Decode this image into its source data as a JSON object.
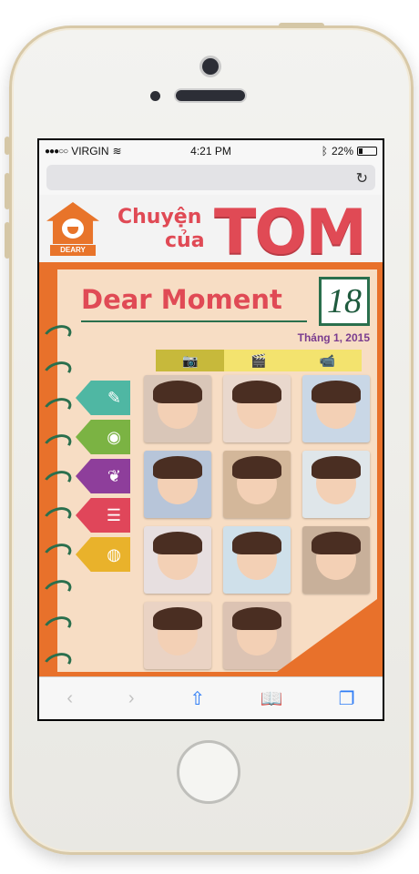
{
  "status_bar": {
    "carrier": "VIRGIN",
    "time": "4:21 PM",
    "battery": "22%"
  },
  "browser": {
    "reload_glyph": "↻"
  },
  "header": {
    "logo_text": "DEARY",
    "title_line1": "Chuyện",
    "title_line2": "của",
    "title_name": "TOM"
  },
  "page": {
    "section_title": "Dear Moment",
    "day_number": "18",
    "month_label": "Tháng 1, 2015"
  },
  "tabs": [
    {
      "icon": "camera-icon",
      "glyph": "📷",
      "active": true
    },
    {
      "icon": "clapperboard-icon",
      "glyph": "🎬",
      "active": false
    },
    {
      "icon": "video-camera-icon",
      "glyph": "📹",
      "active": false
    }
  ],
  "side_tags": [
    {
      "icon": "edit-icon",
      "glyph": "✎",
      "color": "#4fb7a3"
    },
    {
      "icon": "camera-icon",
      "glyph": "◉",
      "color": "#7bb343"
    },
    {
      "icon": "laurel-icon",
      "glyph": "❦",
      "color": "#8e3e9b"
    },
    {
      "icon": "clipboard-icon",
      "glyph": "☰",
      "color": "#e0465a"
    },
    {
      "icon": "globe-icon",
      "glyph": "◍",
      "color": "#e9b22b"
    }
  ],
  "photos": [
    {
      "name": "photo-1",
      "bg": "#d9c6b8"
    },
    {
      "name": "photo-2",
      "bg": "#e9d8cd"
    },
    {
      "name": "photo-3",
      "bg": "#c9d7e6"
    },
    {
      "name": "photo-4",
      "bg": "#b7c5d9"
    },
    {
      "name": "photo-5",
      "bg": "#d3b79a"
    },
    {
      "name": "photo-6",
      "bg": "#dfe6ea"
    },
    {
      "name": "photo-7",
      "bg": "#e7dfe0"
    },
    {
      "name": "photo-8",
      "bg": "#cfe0ea"
    },
    {
      "name": "photo-9",
      "bg": "#c8b09a"
    },
    {
      "name": "photo-10",
      "bg": "#ead3c4"
    },
    {
      "name": "photo-11",
      "bg": "#dcc3b3"
    }
  ],
  "toolbar": {
    "back": "‹",
    "forward": "›",
    "share": "⇧",
    "bookmarks": "📖",
    "tabs": "❐"
  },
  "colors": {
    "accent_red": "#e04a55",
    "accent_orange": "#e8712b",
    "accent_green": "#2a6f4d",
    "accent_purple": "#7a3c8f"
  }
}
